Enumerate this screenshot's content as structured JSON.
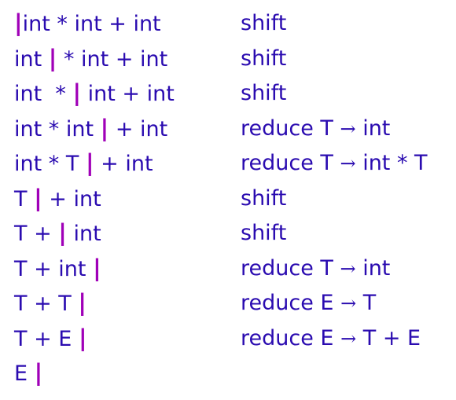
{
  "rows": [
    {
      "before": "",
      "after": "int * int + int",
      "action": "shift"
    },
    {
      "before": "int ",
      "after": " * int + int",
      "action": "shift"
    },
    {
      "before": "int  * ",
      "after": " int + int",
      "action": "shift"
    },
    {
      "before": "int * int ",
      "after": " + int",
      "action": "reduce T",
      "rule": " int"
    },
    {
      "before": "int * T ",
      "after": " + int",
      "action": "reduce T",
      "rule": " int * T"
    },
    {
      "before": "T ",
      "after": " + int",
      "action": "shift"
    },
    {
      "before": "T + ",
      "after": " int",
      "action": "shift"
    },
    {
      "before": "T + int ",
      "after": "",
      "action": "reduce T",
      "rule": " int"
    },
    {
      "before": "T + T ",
      "after": "",
      "action": "reduce E",
      "rule": " T"
    },
    {
      "before": "T + E ",
      "after": "",
      "action": "reduce E",
      "rule": " T + E"
    },
    {
      "before": "E ",
      "after": "",
      "action": ""
    }
  ],
  "cursor_symbol": "|",
  "arrow_symbol": "→",
  "colors": {
    "text": "#2a0bb0",
    "cursor": "#a000b8"
  }
}
